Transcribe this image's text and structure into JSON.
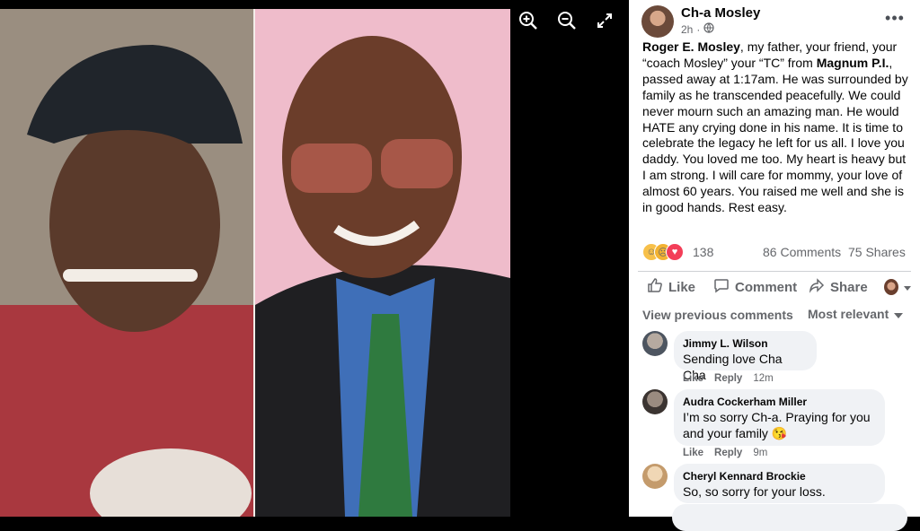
{
  "viewer": {
    "zoom_in_icon": "zoom-in-icon",
    "zoom_out_icon": "zoom-out-icon",
    "fullscreen_icon": "expand-icon"
  },
  "post": {
    "author": "Ch-a Mosley",
    "time": "2h",
    "privacy_icon": "globe-icon",
    "more_label": "•••",
    "body": {
      "p1": "Roger E. Mosley",
      "p2": ", my father, your friend, your “coach Mosley” your “TC” from ",
      "p3": "Magnum P.I.",
      "p4": ", passed away at 1:17am. He was surrounded by family as he transcended peacefully. We could never mourn such an amazing man. He would HATE any crying done in his name. It is time to celebrate the legacy he left for us all. I love you daddy. You loved me too. My heart is heavy but I am strong. I will care for mommy, your love of almost 60 years. You raised me well and she is in good hands. Rest easy."
    },
    "reactions": {
      "count": "138",
      "comments": "86 Comments",
      "shares": "75 Shares"
    },
    "actions": {
      "like": "Like",
      "comment": "Comment",
      "share": "Share"
    },
    "comments_bar": {
      "view_previous": "View previous comments",
      "sort": "Most relevant"
    },
    "comments": [
      {
        "name": "Jimmy L. Wilson",
        "text": "Sending love Cha Cha",
        "like": "Like",
        "reply": "Reply",
        "time": "12m"
      },
      {
        "name": "Audra Cockerham Miller",
        "text": "I’m so sorry Ch-a. Praying for you and your family 😘",
        "like": "Like",
        "reply": "Reply",
        "time": "9m"
      },
      {
        "name": "Cheryl Kennard Brockie",
        "text": "So, so sorry for your loss."
      }
    ]
  }
}
